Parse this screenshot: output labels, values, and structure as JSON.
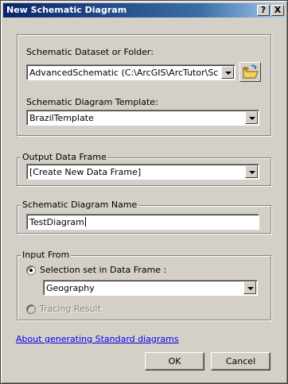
{
  "window": {
    "title": "New Schematic Diagram",
    "help_label": "?",
    "close_label": "X"
  },
  "dataset_group": {
    "dataset_label": "Schematic Dataset or Folder:",
    "dataset_value": "AdvancedSchematic (C:\\ArcGIS\\ArcTutor\\Schematic",
    "template_label": "Schematic Diagram Template:",
    "template_value": "BrazilTemplate"
  },
  "output_frame": {
    "legend": "Output Data Frame",
    "value": "[Create New Data Frame]"
  },
  "diagram_name": {
    "legend": "Schematic Diagram Name",
    "value": "TestDiagram"
  },
  "input_from": {
    "legend": "Input From",
    "selection_label": "Selection set in Data Frame :",
    "selection_checked": true,
    "frame_value": "Geography",
    "tracing_label": "Tracing Result",
    "tracing_enabled": false
  },
  "help_link": "About generating Standard diagrams",
  "buttons": {
    "ok": "OK",
    "cancel": "Cancel"
  },
  "icons": {
    "folder": "open-folder-icon"
  }
}
